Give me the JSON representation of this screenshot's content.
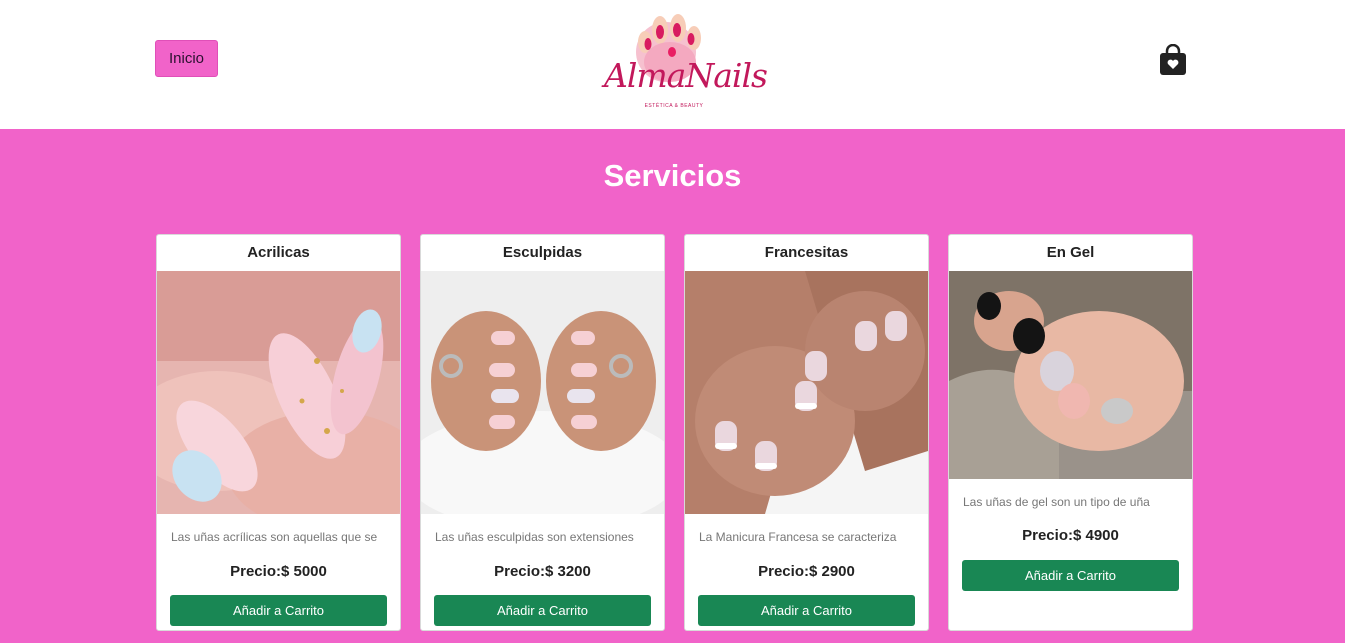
{
  "header": {
    "nav_label": "Inicio",
    "logo_text": "AlmaNails",
    "logo_subtitle": "ESTÉTICA & BEAUTY",
    "cart_icon": "shopping-bag-heart-icon"
  },
  "main": {
    "title": "Servicios",
    "cards": [
      {
        "title": "Acrilicas",
        "description": "Las uñas acrílicas son aquellas que se",
        "price": "Precio:$ 5000",
        "button": "Añadir a Carrito"
      },
      {
        "title": "Esculpidas",
        "description": "Las uñas esculpidas son extensiones",
        "price": "Precio:$ 3200",
        "button": "Añadir a Carrito"
      },
      {
        "title": "Francesitas",
        "description": "La Manicura Francesa se caracteriza",
        "price": "Precio:$ 2900",
        "button": "Añadir a Carrito"
      },
      {
        "title": "En Gel",
        "description": "Las uñas de gel son un tipo de uña",
        "price": "Precio:$ 4900",
        "button": "Añadir a Carrito"
      }
    ]
  },
  "colors": {
    "background": "#f163c9",
    "button_green": "#198754",
    "logo_pink": "#c2185b"
  }
}
